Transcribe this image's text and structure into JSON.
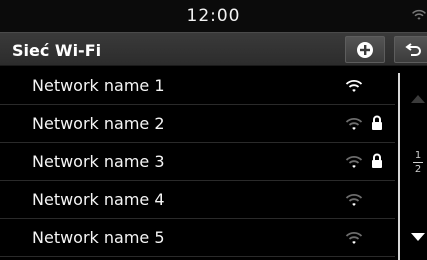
{
  "status": {
    "time": "12:00"
  },
  "header": {
    "title": "Sieć Wi-Fi"
  },
  "networks": [
    {
      "name": "Network name 1",
      "secured": false
    },
    {
      "name": "Network name 2",
      "secured": true
    },
    {
      "name": "Network name 3",
      "secured": true
    },
    {
      "name": "Network name 4",
      "secured": false
    },
    {
      "name": "Network name 5",
      "secured": false
    }
  ],
  "scroll": {
    "current_page": "1",
    "total_pages": "2"
  },
  "colors": {
    "background": "#000000",
    "header": "#333333",
    "text": "#ffffff",
    "divider": "#2a2a2a"
  }
}
